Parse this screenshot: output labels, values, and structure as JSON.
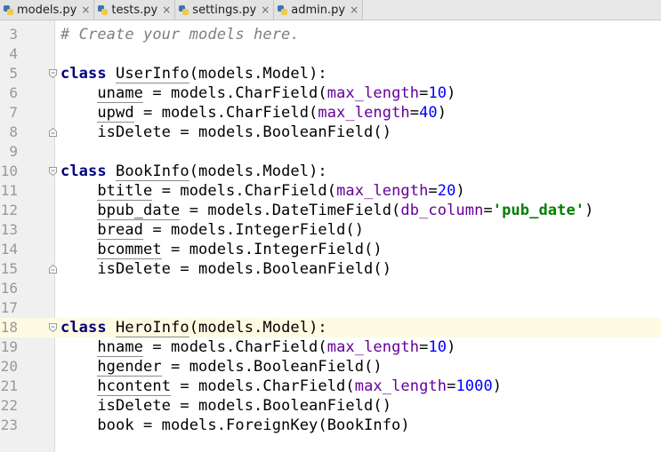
{
  "tabs": [
    {
      "label": "models.py",
      "active": true
    },
    {
      "label": "tests.py",
      "active": false
    },
    {
      "label": "settings.py",
      "active": false
    },
    {
      "label": "admin.py",
      "active": false
    }
  ],
  "close_glyph": "×",
  "current_line": 18,
  "code_lines": [
    {
      "n": "3",
      "fold": "",
      "segments": [
        {
          "t": "# Create your models here.",
          "c": "cm"
        }
      ]
    },
    {
      "n": "4",
      "fold": "",
      "segments": []
    },
    {
      "n": "5",
      "fold": "open",
      "segments": [
        {
          "t": "class",
          "c": "kw"
        },
        {
          "t": " "
        },
        {
          "t": "UserInfo",
          "c": "u"
        },
        {
          "t": "(models.Model):"
        }
      ]
    },
    {
      "n": "6",
      "fold": "",
      "segments": [
        {
          "t": "    "
        },
        {
          "t": "uname",
          "c": "u"
        },
        {
          "t": " = models.CharField("
        },
        {
          "t": "max_length",
          "c": "param"
        },
        {
          "t": "="
        },
        {
          "t": "10",
          "c": "num"
        },
        {
          "t": ")"
        }
      ]
    },
    {
      "n": "7",
      "fold": "",
      "segments": [
        {
          "t": "    "
        },
        {
          "t": "upwd",
          "c": "u"
        },
        {
          "t": " = models.CharField("
        },
        {
          "t": "max_length",
          "c": "param"
        },
        {
          "t": "="
        },
        {
          "t": "40",
          "c": "num"
        },
        {
          "t": ")"
        }
      ]
    },
    {
      "n": "8",
      "fold": "close",
      "segments": [
        {
          "t": "    isDelete = models.BooleanField()"
        }
      ]
    },
    {
      "n": "9",
      "fold": "",
      "segments": []
    },
    {
      "n": "10",
      "fold": "open",
      "segments": [
        {
          "t": "class",
          "c": "kw"
        },
        {
          "t": " "
        },
        {
          "t": "BookInfo",
          "c": "u"
        },
        {
          "t": "(models.Model):"
        }
      ]
    },
    {
      "n": "11",
      "fold": "",
      "segments": [
        {
          "t": "    "
        },
        {
          "t": "btitle",
          "c": "u"
        },
        {
          "t": " = models.CharField("
        },
        {
          "t": "max_length",
          "c": "param"
        },
        {
          "t": "="
        },
        {
          "t": "20",
          "c": "num"
        },
        {
          "t": ")"
        }
      ]
    },
    {
      "n": "12",
      "fold": "",
      "segments": [
        {
          "t": "    "
        },
        {
          "t": "bpub_date",
          "c": "u"
        },
        {
          "t": " = models.DateTimeField("
        },
        {
          "t": "db_column",
          "c": "param"
        },
        {
          "t": "="
        },
        {
          "t": "'pub_date'",
          "c": "str"
        },
        {
          "t": ")"
        }
      ]
    },
    {
      "n": "13",
      "fold": "",
      "segments": [
        {
          "t": "    "
        },
        {
          "t": "bread",
          "c": "u"
        },
        {
          "t": " = models.IntegerField()"
        }
      ]
    },
    {
      "n": "14",
      "fold": "",
      "segments": [
        {
          "t": "    "
        },
        {
          "t": "bcommet",
          "c": "u"
        },
        {
          "t": " = models.IntegerField()"
        }
      ]
    },
    {
      "n": "15",
      "fold": "close",
      "segments": [
        {
          "t": "    isDelete = models.BooleanField()"
        }
      ]
    },
    {
      "n": "16",
      "fold": "",
      "segments": []
    },
    {
      "n": "17",
      "fold": "",
      "segments": []
    },
    {
      "n": "18",
      "fold": "open",
      "segments": [
        {
          "t": "class",
          "c": "kw"
        },
        {
          "t": " "
        },
        {
          "t": "HeroInfo",
          "c": "u"
        },
        {
          "t": "(models.Model):"
        }
      ]
    },
    {
      "n": "19",
      "fold": "",
      "segments": [
        {
          "t": "    "
        },
        {
          "t": "hname",
          "c": "u"
        },
        {
          "t": " = models.CharField("
        },
        {
          "t": "max_length",
          "c": "param"
        },
        {
          "t": "="
        },
        {
          "t": "10",
          "c": "num"
        },
        {
          "t": ")"
        }
      ]
    },
    {
      "n": "20",
      "fold": "",
      "segments": [
        {
          "t": "    "
        },
        {
          "t": "hgender",
          "c": "u"
        },
        {
          "t": " = models.BooleanField()"
        }
      ]
    },
    {
      "n": "21",
      "fold": "",
      "segments": [
        {
          "t": "    "
        },
        {
          "t": "hcontent",
          "c": "u"
        },
        {
          "t": " = models.CharField("
        },
        {
          "t": "max_length",
          "c": "param"
        },
        {
          "t": "="
        },
        {
          "t": "1000",
          "c": "num"
        },
        {
          "t": ")"
        }
      ]
    },
    {
      "n": "22",
      "fold": "",
      "segments": [
        {
          "t": "    isDelete = models.BooleanField()"
        }
      ]
    },
    {
      "n": "23",
      "fold": "",
      "segments": [
        {
          "t": "    book = models.ForeignKey(BookInfo)"
        }
      ]
    }
  ],
  "colors": {
    "keyword": "#000080",
    "comment": "#808080",
    "param": "#660099",
    "number": "#0000ff",
    "string": "#008000",
    "current_line_bg": "#fffbe3"
  }
}
